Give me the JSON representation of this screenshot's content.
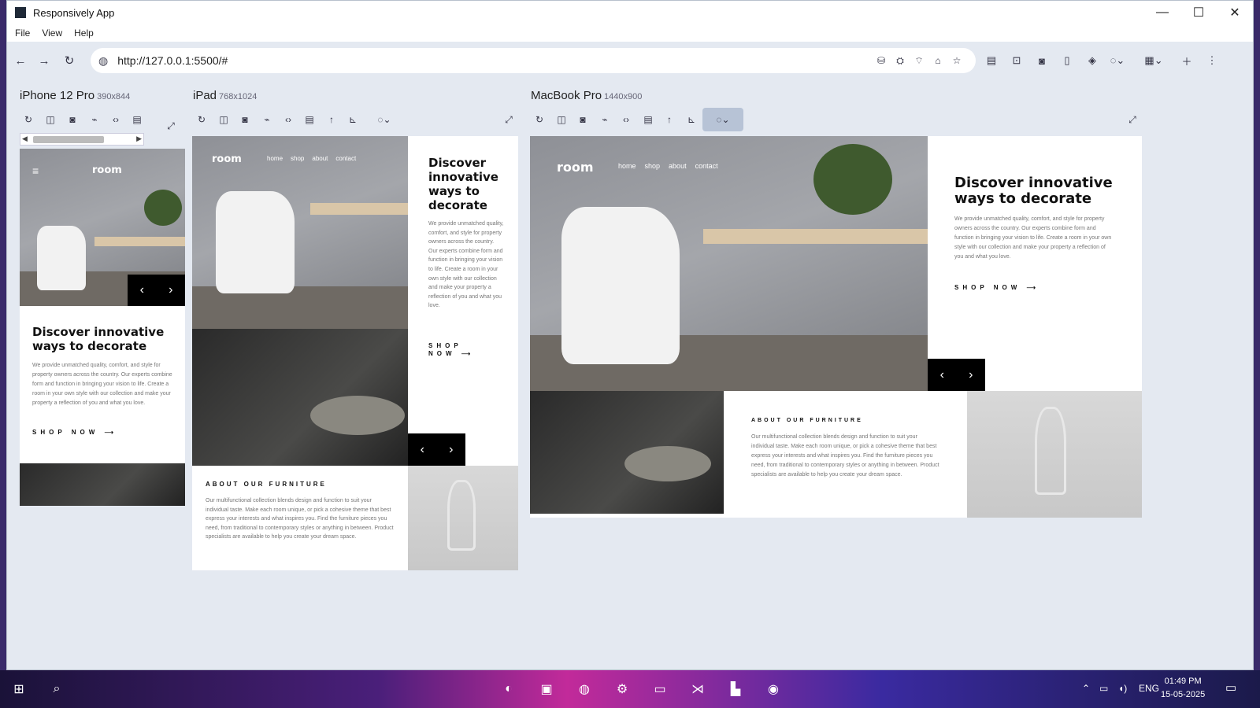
{
  "window": {
    "title": "Responsively App",
    "controls": [
      "—",
      "☐",
      "✕"
    ]
  },
  "menu": [
    "File",
    "View",
    "Help"
  ],
  "address": {
    "url": "http://127.0.0.1:5500/#"
  },
  "devices": [
    {
      "name": "iPhone 12 Pro",
      "dims": "390x844"
    },
    {
      "name": "iPad",
      "dims": "768x1024"
    },
    {
      "name": "MacBook Pro",
      "dims": "1440x900"
    }
  ],
  "site": {
    "logo": "room",
    "nav": [
      "home",
      "shop",
      "about",
      "contact"
    ],
    "heading": "Discover innovative ways to decorate",
    "paragraph_long": "We provide unmatched quality, comfort, and style for property owners across the country. Our experts combine form and function in bringing your vision to life. Create a room in your own style with our collection and make your property a reflection of you and what you love.",
    "shop": "SHOP NOW",
    "about_heading": "ABOUT OUR FURNITURE",
    "about_text": "Our multifunctional collection blends design and function to suit your individual taste. Make each room unique, or pick a cohesive theme that best express your interests and what inspires you. Find the furniture pieces you need, from traditional to contemporary styles or anything in between. Product specialists are available to help you create your dream space."
  },
  "taskbar": {
    "lang": "ENG",
    "time": "01:49 PM",
    "date": "15-05-2025"
  }
}
